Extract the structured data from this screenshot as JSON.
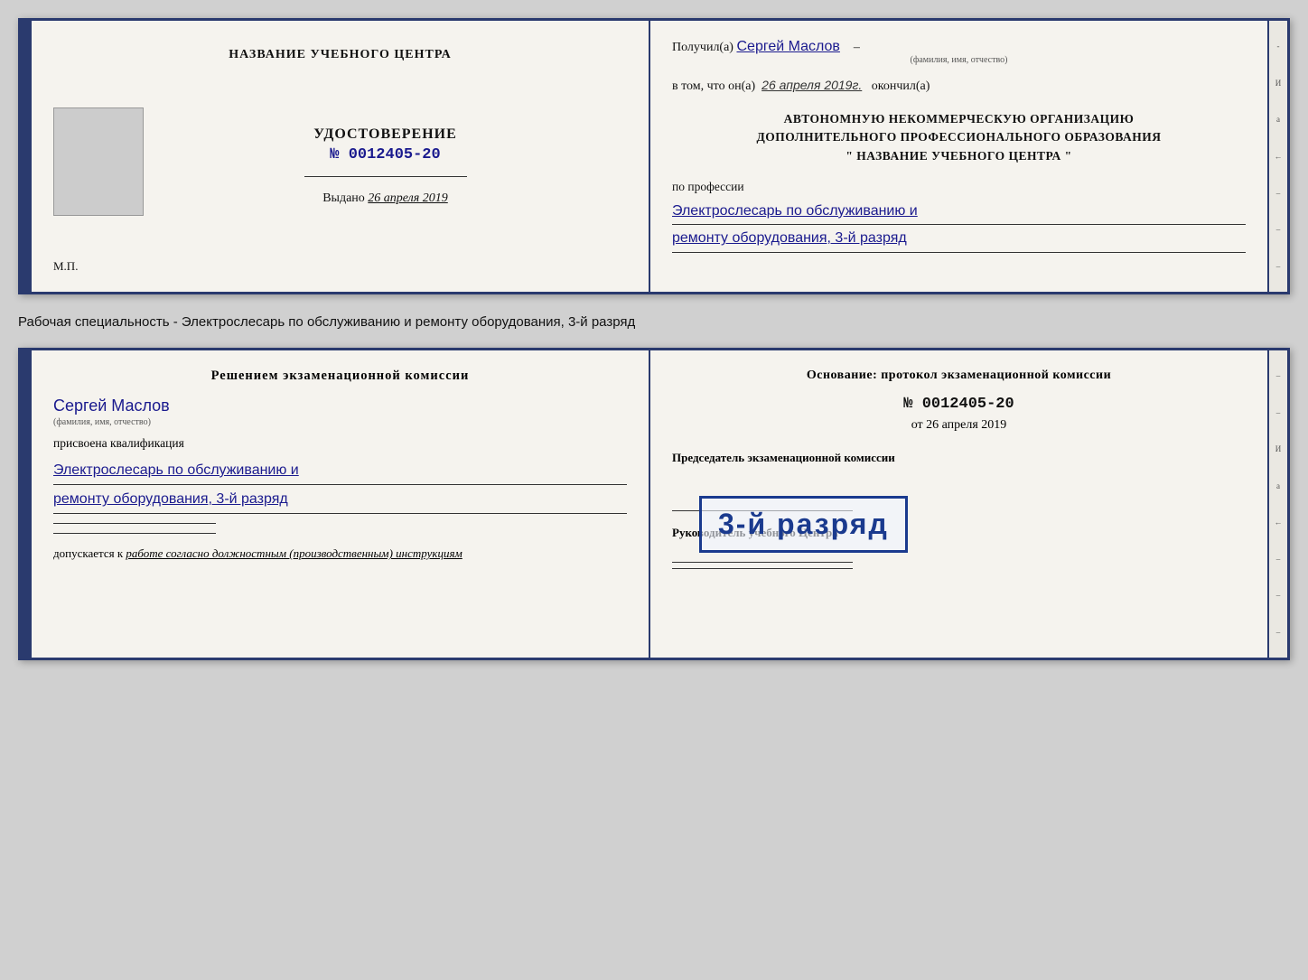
{
  "top_booklet": {
    "left": {
      "center_title": "НАЗВАНИЕ УЧЕБНОГО ЦЕНТРА",
      "udostoverenie": "УДОСТОВЕРЕНИЕ",
      "number_prefix": "№",
      "number": "0012405-20",
      "vydano_label": "Выдано",
      "vydano_date": "26 апреля 2019",
      "mp": "М.П."
    },
    "right": {
      "poluchil_label": "Получил(а)",
      "poluchil_name": "Сергей Маслов",
      "fio_hint": "(фамилия, имя, отчество)",
      "vtom_label": "в том, что он(а)",
      "vtom_date": "26 апреля 2019г.",
      "okonchil": "окончил(а)",
      "org_line1": "АВТОНОМНУЮ НЕКОММЕРЧЕСКУЮ ОРГАНИЗАЦИЮ",
      "org_line2": "ДОПОЛНИТЕЛЬНОГО ПРОФЕССИОНАЛЬНОГО ОБРАЗОВАНИЯ",
      "org_line3": "\"  НАЗВАНИЕ УЧЕБНОГО ЦЕНТРА  \"",
      "po_professii": "по профессии",
      "profession_line1": "Электрослесарь по обслуживанию и",
      "profession_line2": "ремонту оборудования, 3-й разряд"
    }
  },
  "separator": {
    "text": "Рабочая специальность - Электрослесарь по обслуживанию и ремонту оборудования, 3-й разряд"
  },
  "bottom_booklet": {
    "left": {
      "resheniem": "Решением экзаменационной комиссии",
      "name": "Сергей Маслов",
      "fio_hint": "(фамилия, имя, отчество)",
      "prisvoena": "присвоена квалификация",
      "kvalifikaciya_line1": "Электрослесарь по обслуживанию и",
      "kvalifikaciya_line2": "ремонту оборудования, 3-й разряд",
      "dopuskaetsya": "допускается к",
      "dopuskaetsya_text": "работе согласно должностным (производственным) инструкциям"
    },
    "right": {
      "osnovanie": "Основание: протокол экзаменационной комиссии",
      "number_prefix": "№",
      "number": "0012405-20",
      "ot_label": "от",
      "ot_date": "26 апреля 2019",
      "predsedatel": "Председатель экзаменационной комиссии",
      "stamp_text": "3-й разряд",
      "rukovoditel": "Руководитель учебного Центра"
    }
  },
  "right_deco": {
    "items": [
      "-",
      "И",
      "а",
      "←",
      "-",
      "-",
      "-"
    ]
  }
}
